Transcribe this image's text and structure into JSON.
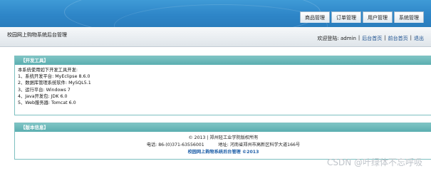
{
  "nav": {
    "tabs": [
      "商品管理",
      "订单管理",
      "用户管理",
      "系统管理"
    ]
  },
  "subheader": {
    "title": "校园网上购物系统后台管理",
    "welcome": "欢迎登陆: admin",
    "sep1": "|",
    "home": "后台首页",
    "sep2": "|",
    "front": "前台首页",
    "sep3": "|",
    "logout": "退出"
  },
  "dev_panel": {
    "title": "【开发工具】",
    "intro": "本系统使用如下开发工具开发:",
    "tools": [
      "1、系统开发平台: MyEclipse 8.6.0",
      "2、数据库管理系统软件: MySQL5.1",
      "3、运行平台: Windows 7",
      "4、Java开发包: JDK 6.0",
      "5、Web服务器: Tomcat 6.0"
    ]
  },
  "copyright_panel": {
    "title": "【版本信息】",
    "line1": "© 2013 | 郑州轻工业学院版权所有",
    "line2": "电话: 86-(0)371-63556001          地址: 河南省郑州市高新区科学大道166号",
    "line3": "校园网上购物系统后台管理 ©2013"
  },
  "watermark": "CSDN @叶绿体不忘呼吸"
}
